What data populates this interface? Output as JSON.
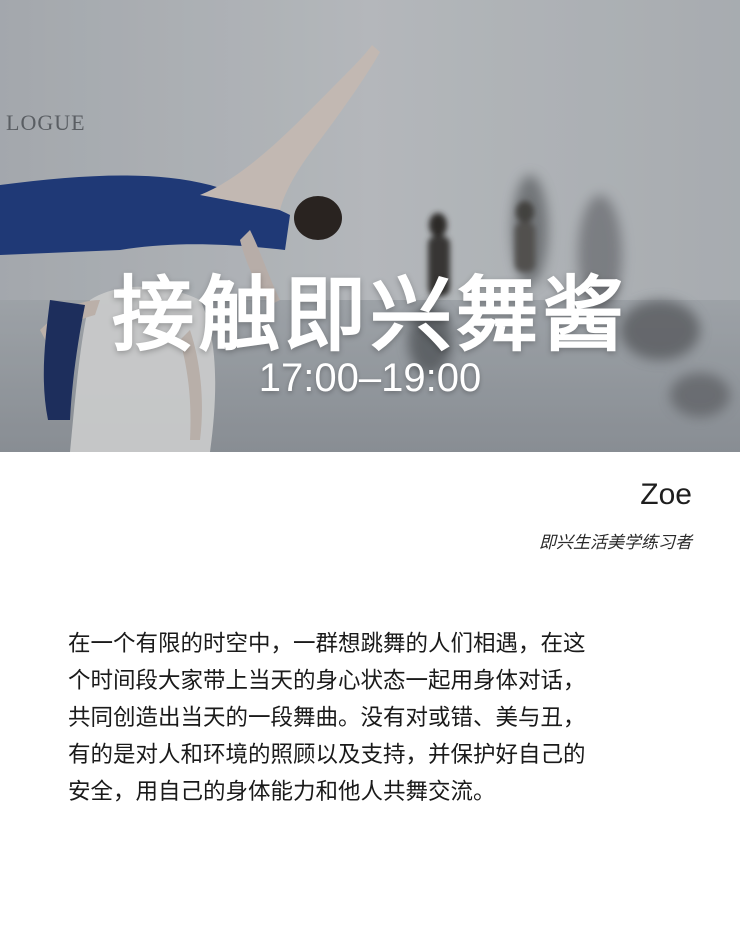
{
  "hero": {
    "title": "接触即兴舞酱",
    "time": "17:00–19:00",
    "background_text": "LOGUE"
  },
  "author": {
    "name": "Zoe",
    "role": "即兴生活美学练习者"
  },
  "description": {
    "lines": [
      "在一个有限的时空中，一群想跳舞的人们相遇，在这",
      "个时间段大家带上当天的身心状态一起用身体对话，",
      "共同创造出当天的一段舞曲。没有对或错、美与丑，",
      "有的是对人和环境的照顾以及支持，并保护好自己的",
      "安全，用自己的身体能力和他人共舞交流。"
    ]
  },
  "colors": {
    "hero_text": "#ffffff",
    "dancer_top": "#1f3f8a",
    "body_text": "#1a1a1a"
  }
}
